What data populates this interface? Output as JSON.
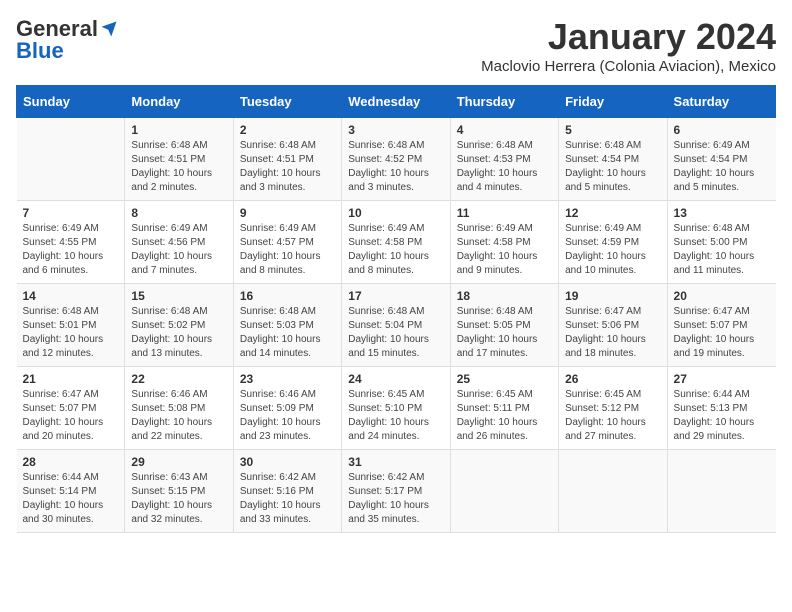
{
  "header": {
    "logo": {
      "general": "General",
      "blue": "Blue"
    },
    "title": "January 2024",
    "location": "Maclovio Herrera (Colonia Aviacion), Mexico"
  },
  "weekdays": [
    "Sunday",
    "Monday",
    "Tuesday",
    "Wednesday",
    "Thursday",
    "Friday",
    "Saturday"
  ],
  "weeks": [
    [
      {
        "num": "",
        "info": ""
      },
      {
        "num": "1",
        "info": "Sunrise: 6:48 AM\nSunset: 4:51 PM\nDaylight: 10 hours\nand 2 minutes."
      },
      {
        "num": "2",
        "info": "Sunrise: 6:48 AM\nSunset: 4:51 PM\nDaylight: 10 hours\nand 3 minutes."
      },
      {
        "num": "3",
        "info": "Sunrise: 6:48 AM\nSunset: 4:52 PM\nDaylight: 10 hours\nand 3 minutes."
      },
      {
        "num": "4",
        "info": "Sunrise: 6:48 AM\nSunset: 4:53 PM\nDaylight: 10 hours\nand 4 minutes."
      },
      {
        "num": "5",
        "info": "Sunrise: 6:48 AM\nSunset: 4:54 PM\nDaylight: 10 hours\nand 5 minutes."
      },
      {
        "num": "6",
        "info": "Sunrise: 6:49 AM\nSunset: 4:54 PM\nDaylight: 10 hours\nand 5 minutes."
      }
    ],
    [
      {
        "num": "7",
        "info": "Sunrise: 6:49 AM\nSunset: 4:55 PM\nDaylight: 10 hours\nand 6 minutes."
      },
      {
        "num": "8",
        "info": "Sunrise: 6:49 AM\nSunset: 4:56 PM\nDaylight: 10 hours\nand 7 minutes."
      },
      {
        "num": "9",
        "info": "Sunrise: 6:49 AM\nSunset: 4:57 PM\nDaylight: 10 hours\nand 8 minutes."
      },
      {
        "num": "10",
        "info": "Sunrise: 6:49 AM\nSunset: 4:58 PM\nDaylight: 10 hours\nand 8 minutes."
      },
      {
        "num": "11",
        "info": "Sunrise: 6:49 AM\nSunset: 4:58 PM\nDaylight: 10 hours\nand 9 minutes."
      },
      {
        "num": "12",
        "info": "Sunrise: 6:49 AM\nSunset: 4:59 PM\nDaylight: 10 hours\nand 10 minutes."
      },
      {
        "num": "13",
        "info": "Sunrise: 6:48 AM\nSunset: 5:00 PM\nDaylight: 10 hours\nand 11 minutes."
      }
    ],
    [
      {
        "num": "14",
        "info": "Sunrise: 6:48 AM\nSunset: 5:01 PM\nDaylight: 10 hours\nand 12 minutes."
      },
      {
        "num": "15",
        "info": "Sunrise: 6:48 AM\nSunset: 5:02 PM\nDaylight: 10 hours\nand 13 minutes."
      },
      {
        "num": "16",
        "info": "Sunrise: 6:48 AM\nSunset: 5:03 PM\nDaylight: 10 hours\nand 14 minutes."
      },
      {
        "num": "17",
        "info": "Sunrise: 6:48 AM\nSunset: 5:04 PM\nDaylight: 10 hours\nand 15 minutes."
      },
      {
        "num": "18",
        "info": "Sunrise: 6:48 AM\nSunset: 5:05 PM\nDaylight: 10 hours\nand 17 minutes."
      },
      {
        "num": "19",
        "info": "Sunrise: 6:47 AM\nSunset: 5:06 PM\nDaylight: 10 hours\nand 18 minutes."
      },
      {
        "num": "20",
        "info": "Sunrise: 6:47 AM\nSunset: 5:07 PM\nDaylight: 10 hours\nand 19 minutes."
      }
    ],
    [
      {
        "num": "21",
        "info": "Sunrise: 6:47 AM\nSunset: 5:07 PM\nDaylight: 10 hours\nand 20 minutes."
      },
      {
        "num": "22",
        "info": "Sunrise: 6:46 AM\nSunset: 5:08 PM\nDaylight: 10 hours\nand 22 minutes."
      },
      {
        "num": "23",
        "info": "Sunrise: 6:46 AM\nSunset: 5:09 PM\nDaylight: 10 hours\nand 23 minutes."
      },
      {
        "num": "24",
        "info": "Sunrise: 6:45 AM\nSunset: 5:10 PM\nDaylight: 10 hours\nand 24 minutes."
      },
      {
        "num": "25",
        "info": "Sunrise: 6:45 AM\nSunset: 5:11 PM\nDaylight: 10 hours\nand 26 minutes."
      },
      {
        "num": "26",
        "info": "Sunrise: 6:45 AM\nSunset: 5:12 PM\nDaylight: 10 hours\nand 27 minutes."
      },
      {
        "num": "27",
        "info": "Sunrise: 6:44 AM\nSunset: 5:13 PM\nDaylight: 10 hours\nand 29 minutes."
      }
    ],
    [
      {
        "num": "28",
        "info": "Sunrise: 6:44 AM\nSunset: 5:14 PM\nDaylight: 10 hours\nand 30 minutes."
      },
      {
        "num": "29",
        "info": "Sunrise: 6:43 AM\nSunset: 5:15 PM\nDaylight: 10 hours\nand 32 minutes."
      },
      {
        "num": "30",
        "info": "Sunrise: 6:42 AM\nSunset: 5:16 PM\nDaylight: 10 hours\nand 33 minutes."
      },
      {
        "num": "31",
        "info": "Sunrise: 6:42 AM\nSunset: 5:17 PM\nDaylight: 10 hours\nand 35 minutes."
      },
      {
        "num": "",
        "info": ""
      },
      {
        "num": "",
        "info": ""
      },
      {
        "num": "",
        "info": ""
      }
    ]
  ]
}
